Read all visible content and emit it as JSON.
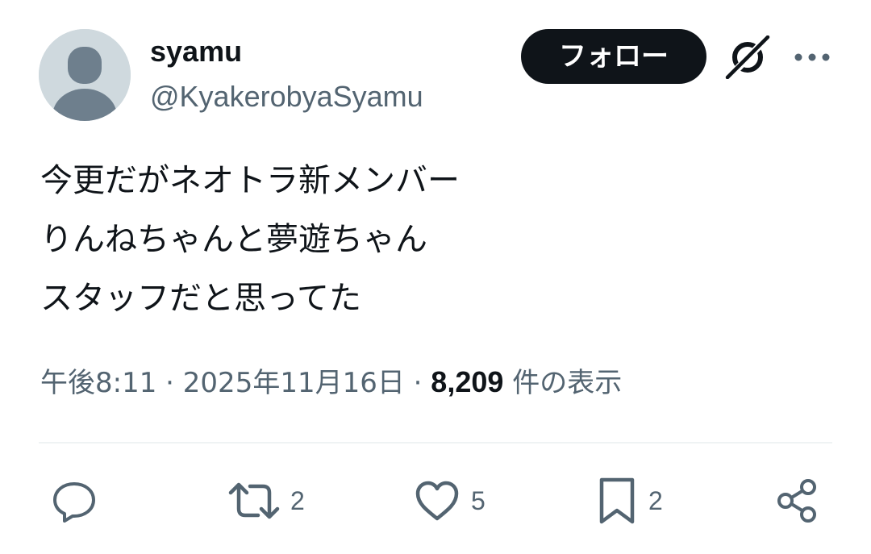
{
  "user": {
    "display_name": "syamu",
    "handle": "@KyakerobyaSyamu",
    "avatar_icon": "default-avatar-icon"
  },
  "header": {
    "follow_label": "フォロー",
    "grok_icon": "grok-icon",
    "more_icon": "more-icon"
  },
  "tweet": {
    "lines": [
      "今更だがネオトラ新メンバー",
      "りんねちゃんと夢遊ちゃん",
      "スタッフだと思ってた"
    ]
  },
  "meta": {
    "time": "午後8:11",
    "separator": "·",
    "date": "2025年11月16日",
    "views_count": "8,209",
    "views_label": "件の表示"
  },
  "actions": {
    "reply": {
      "icon": "reply-icon",
      "count": ""
    },
    "retweet": {
      "icon": "retweet-icon",
      "count": "2"
    },
    "like": {
      "icon": "heart-icon",
      "count": "5"
    },
    "bookmark": {
      "icon": "bookmark-icon",
      "count": "2"
    },
    "share": {
      "icon": "share-icon"
    }
  },
  "colors": {
    "text_primary": "#0f1419",
    "text_secondary": "#536471",
    "avatar_bg": "#cfd9de",
    "avatar_figure": "#6e7f8d",
    "divider": "#eff3f4"
  }
}
